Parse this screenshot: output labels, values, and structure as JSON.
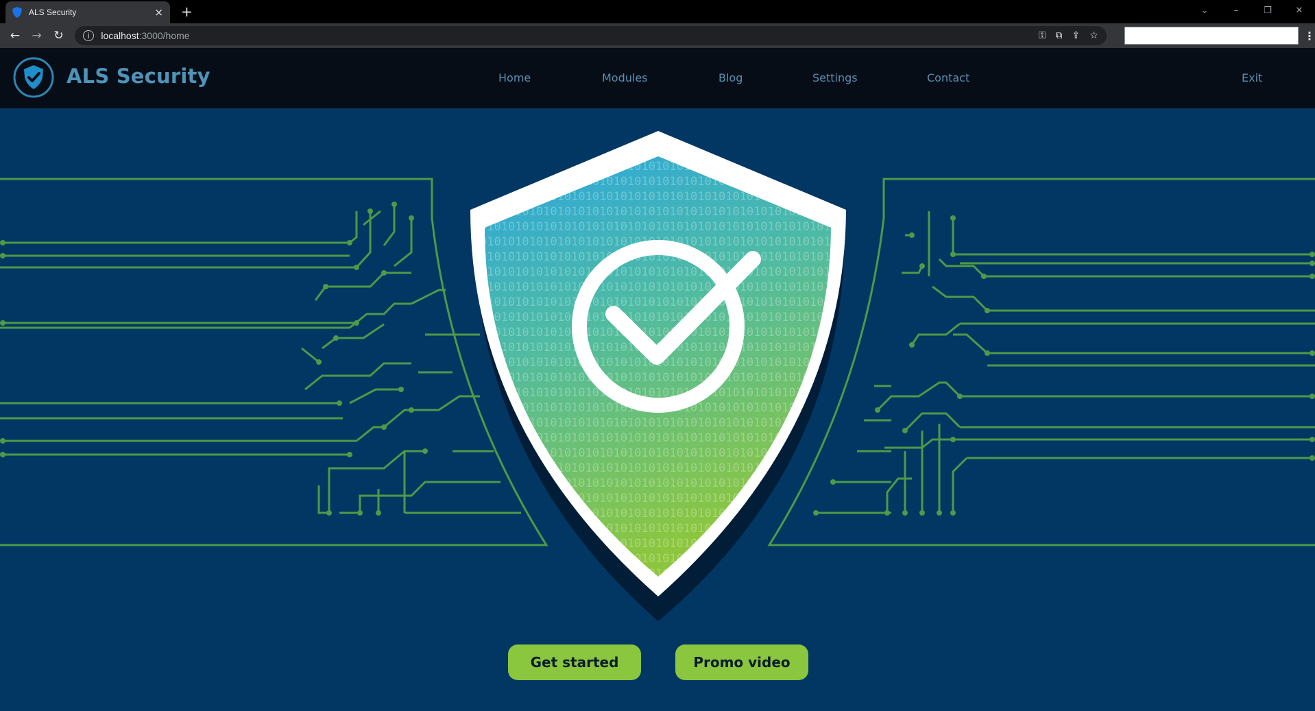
{
  "browser": {
    "tab_title": "ALS Security",
    "close_glyph": "×",
    "newtab_glyph": "+",
    "url_host": "localhost",
    "url_path": ":3000/home",
    "window_controls": [
      "⌄",
      "–",
      "❐",
      "✕"
    ]
  },
  "site": {
    "brand": "ALS Security",
    "nav": [
      "Home",
      "Modules",
      "Blog",
      "Settings",
      "Contact"
    ],
    "exit": "Exit"
  },
  "hero": {
    "primary_button": "Get started",
    "secondary_button": "Promo video",
    "binary_text": "0101010101010101010101010101010101010101010101010101010101010101"
  },
  "colors": {
    "page_bg": "#023763",
    "nav_bg": "#070d17",
    "accent_green": "#8ac63e",
    "circuit": "#4d9a48",
    "shield_top": "#2aa6e0",
    "shield_bottom": "#8cc63f"
  }
}
